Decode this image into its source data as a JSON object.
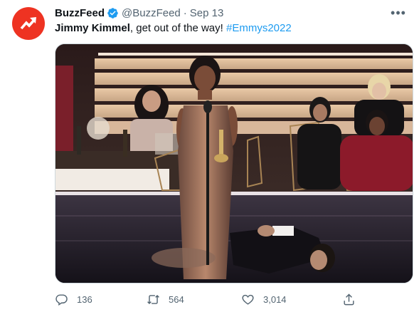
{
  "author": {
    "name": "BuzzFeed",
    "handle": "@BuzzFeed",
    "separator": "·",
    "date": "Sep 13",
    "verified": true,
    "avatar_icon": "buzzfeed-trending-arrow-icon",
    "avatar_color": "#ee3322"
  },
  "more_label": "•••",
  "tweet": {
    "bold_text": "Jimmy Kimmel",
    "text": ", get out of the way! ",
    "hashtag": "#Emmys2022"
  },
  "media": {
    "description_icon": "photo"
  },
  "actions": {
    "replies": "136",
    "retweets": "564",
    "likes": "3,014"
  },
  "colors": {
    "link": "#1d9bf0",
    "muted": "#536471",
    "text": "#0f1419"
  }
}
